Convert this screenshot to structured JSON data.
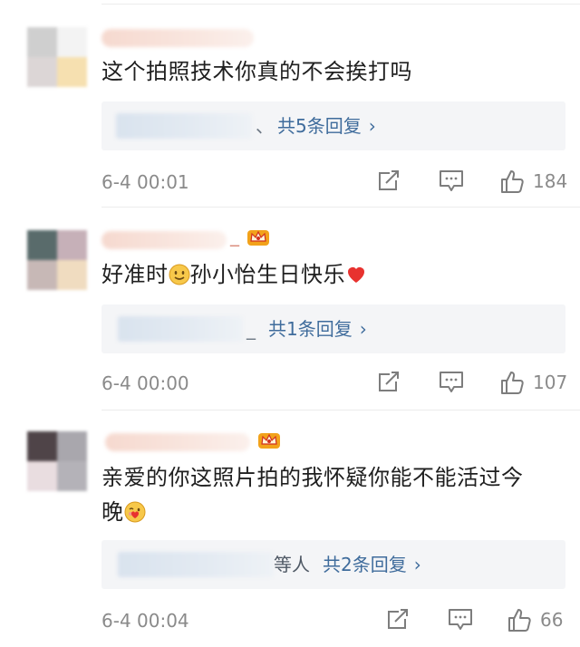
{
  "comments": [
    {
      "text": "这个拍照技术你真的不会挨打吗",
      "reply_tail": "、",
      "reply_link": "共5条回复",
      "time": "6-4 00:01",
      "likes": "184",
      "icons": [
        "repost-icon",
        "comment-icon",
        "like-icon"
      ]
    },
    {
      "text": "好准时",
      "text_after_emoji": "孙小怡生日快乐",
      "username_suffix": "_",
      "reply_tail": "_",
      "reply_link": "共1条回复",
      "time": "6-4 00:00",
      "likes": "107",
      "icons": [
        "crown-badge-icon",
        "smile-emoji-icon",
        "heart-emoji-icon",
        "repost-icon",
        "comment-icon",
        "like-icon"
      ]
    },
    {
      "text": "亲爱的你这照片拍的我怀疑你能不能活过今",
      "text_line2": "晚",
      "reply_tail": "等人",
      "reply_link": "共2条回复",
      "time": "6-4 00:04",
      "likes": "66",
      "icons": [
        "crown-badge-icon",
        "wink-kiss-emoji-icon",
        "repost-icon",
        "comment-icon",
        "like-icon"
      ]
    }
  ],
  "reply_chevron": "›",
  "colors": {
    "link": "#3f6c9c",
    "meta": "#8a8a8a",
    "reply_bg": "#f4f5f7",
    "text": "#1f1f1f",
    "heart": "#e8322f"
  }
}
